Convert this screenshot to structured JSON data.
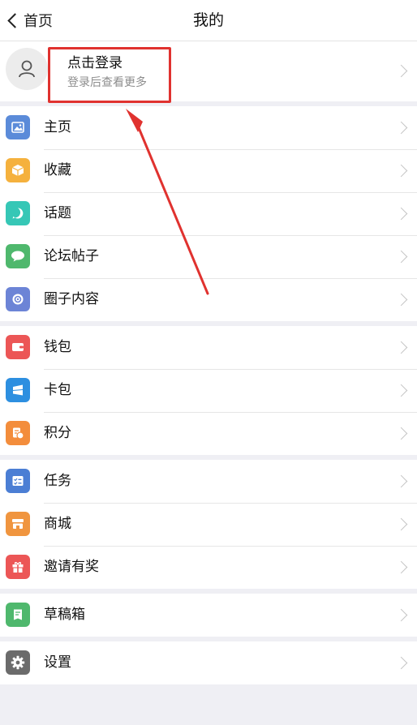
{
  "nav": {
    "back_label": "首页",
    "title": "我的"
  },
  "profile": {
    "login_label": "点击登录",
    "login_sub": "登录后查看更多"
  },
  "groups": [
    [
      {
        "label": "主页",
        "icon": "image-icon",
        "color": "#5b8bd9"
      },
      {
        "label": "收藏",
        "icon": "box-icon",
        "color": "#f5b13d"
      },
      {
        "label": "话题",
        "icon": "hashtag-icon",
        "color": "#36c7b6"
      },
      {
        "label": "论坛帖子",
        "icon": "chat-icon",
        "color": "#4fb86d"
      },
      {
        "label": "圈子内容",
        "icon": "circle-icon",
        "color": "#6c84d6"
      }
    ],
    [
      {
        "label": "钱包",
        "icon": "wallet-icon",
        "color": "#ec5656"
      },
      {
        "label": "卡包",
        "icon": "card-icon",
        "color": "#2d8fe0"
      },
      {
        "label": "积分",
        "icon": "points-icon",
        "color": "#f38d3c"
      }
    ],
    [
      {
        "label": "任务",
        "icon": "task-icon",
        "color": "#4b7ed4"
      },
      {
        "label": "商城",
        "icon": "store-icon",
        "color": "#f0953f"
      },
      {
        "label": "邀请有奖",
        "icon": "gift-icon",
        "color": "#ec5656"
      }
    ],
    [
      {
        "label": "草稿箱",
        "icon": "draft-icon",
        "color": "#4fb86d"
      }
    ],
    [
      {
        "label": "设置",
        "icon": "gear-icon",
        "color": "#6b6b6b"
      }
    ]
  ],
  "colors": {
    "highlight": "#e0322f",
    "background": "#efeff4"
  }
}
